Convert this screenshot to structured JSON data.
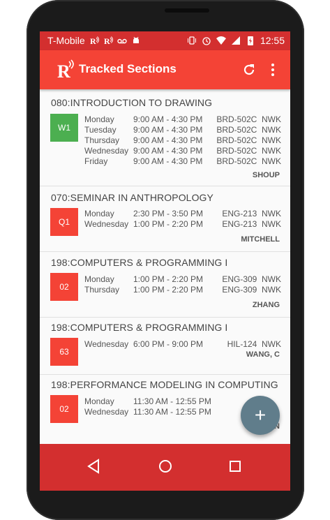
{
  "status_bar": {
    "carrier": "T-Mobile",
    "time": "12:55",
    "icons": [
      "nfc-r-icon",
      "nfc-r-icon",
      "voicemail-icon",
      "android-debug-icon",
      "vibrate-icon",
      "alarm-icon",
      "wifi-icon",
      "signal-icon",
      "battery-charging-icon"
    ]
  },
  "app_bar": {
    "title": "Tracked Sections",
    "actions": [
      "refresh-icon",
      "more-vert-icon"
    ]
  },
  "sections": [
    {
      "title": "080:INTRODUCTION TO DRAWING",
      "badge": "W1",
      "badge_color": "#4caf50",
      "meetings": [
        {
          "day": "Monday",
          "time": "9:00 AM - 4:30 PM",
          "room": "BRD-502C  NWK"
        },
        {
          "day": "Tuesday",
          "time": "9:00 AM - 4:30 PM",
          "room": "BRD-502C  NWK"
        },
        {
          "day": "Thursday",
          "time": "9:00 AM - 4:30 PM",
          "room": "BRD-502C  NWK"
        },
        {
          "day": "Wednesday",
          "time": "9:00 AM - 4:30 PM",
          "room": "BRD-502C  NWK"
        },
        {
          "day": "Friday",
          "time": "9:00 AM - 4:30 PM",
          "room": "BRD-502C  NWK"
        }
      ],
      "instructor": "SHOUP"
    },
    {
      "title": "070:SEMINAR IN ANTHROPOLOGY",
      "badge": "Q1",
      "badge_color": "#f44336",
      "meetings": [
        {
          "day": "Monday",
          "time": "2:30 PM - 3:50 PM",
          "room": "ENG-213  NWK"
        },
        {
          "day": "Wednesday",
          "time": "1:00 PM - 2:20 PM",
          "room": "ENG-213  NWK"
        }
      ],
      "instructor": "MITCHELL"
    },
    {
      "title": "198:COMPUTERS & PROGRAMMING I",
      "badge": "02",
      "badge_color": "#f44336",
      "meetings": [
        {
          "day": "Monday",
          "time": "1:00 PM - 2:20 PM",
          "room": "ENG-309  NWK"
        },
        {
          "day": "Thursday",
          "time": "1:00 PM - 2:20 PM",
          "room": "ENG-309  NWK"
        }
      ],
      "instructor": "ZHANG"
    },
    {
      "title": "198:COMPUTERS & PROGRAMMING I",
      "badge": "63",
      "badge_color": "#f44336",
      "meetings": [
        {
          "day": "Wednesday",
          "time": "6:00 PM - 9:00 PM",
          "room": "HIL-124  NWK"
        }
      ],
      "instructor": "WANG, C"
    },
    {
      "title": "198:PERFORMANCE MODELING IN COMPUTING",
      "badge": "02",
      "badge_color": "#f44336",
      "meetings": [
        {
          "day": "Monday",
          "time": "11:30 AM - 12:55 PM",
          "room": ""
        },
        {
          "day": "Wednesday",
          "time": "11:30 AM - 12:55 PM",
          "room": ""
        }
      ],
      "instructor": "N"
    }
  ],
  "fab": {
    "icon": "plus-icon",
    "label": "+"
  },
  "nav_bar": {
    "buttons": [
      "back-icon",
      "home-icon",
      "recents-icon"
    ]
  }
}
